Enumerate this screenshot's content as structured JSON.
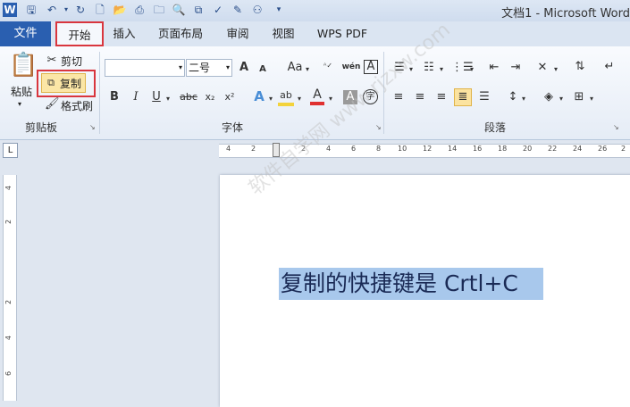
{
  "window": {
    "title": "文档1 - Microsoft Word"
  },
  "quick_access": [
    "word-logo-icon",
    "save-icon",
    "undo-icon",
    "redo-icon",
    "new-document-icon",
    "open-folder-icon",
    "folder-icon",
    "print-preview-icon",
    "print-icon",
    "spell-check-icon",
    "edit-icon",
    "tree-icon",
    "customize-icon"
  ],
  "tabs": [
    {
      "label": "文件"
    },
    {
      "label": "开始"
    },
    {
      "label": "插入"
    },
    {
      "label": "页面布局"
    },
    {
      "label": "审阅"
    },
    {
      "label": "视图"
    },
    {
      "label": "WPS PDF"
    }
  ],
  "clipboard": {
    "paste_label": "粘贴",
    "cut_label": "剪切",
    "copy_label": "复制",
    "format_painter_label": "格式刷",
    "group_label": "剪贴板"
  },
  "font": {
    "font_name": "",
    "font_size": "二号",
    "group_label": "字体",
    "bold": "B",
    "italic": "I",
    "underline": "U",
    "strikethrough": "abc",
    "subscript": "x₂",
    "superscript": "x²",
    "grow": "A",
    "shrink": "A",
    "case": "Aa",
    "phonetic": "wén",
    "char_border": "A",
    "font_color": "A",
    "char_shading": "A",
    "enclose": "字"
  },
  "paragraph": {
    "group_label": "段落"
  },
  "ruler": {
    "marks": [
      "4",
      "2",
      "2",
      "4",
      "6",
      "8",
      "10",
      "12",
      "14",
      "16",
      "18",
      "20",
      "22",
      "24",
      "26",
      "2"
    ]
  },
  "vruler": {
    "marks": [
      "4",
      "2",
      "2",
      "4",
      "6"
    ]
  },
  "document": {
    "text": "复制的快捷键是 Crtl+C"
  },
  "watermark": {
    "text": "软件自学网 www.rjzxw.com"
  },
  "colors": {
    "file_tab": "#2a5fb0",
    "highlight": "#a8c8ec",
    "font_color_bar": "#e03030",
    "highlight_tool": "#f3d33c"
  }
}
